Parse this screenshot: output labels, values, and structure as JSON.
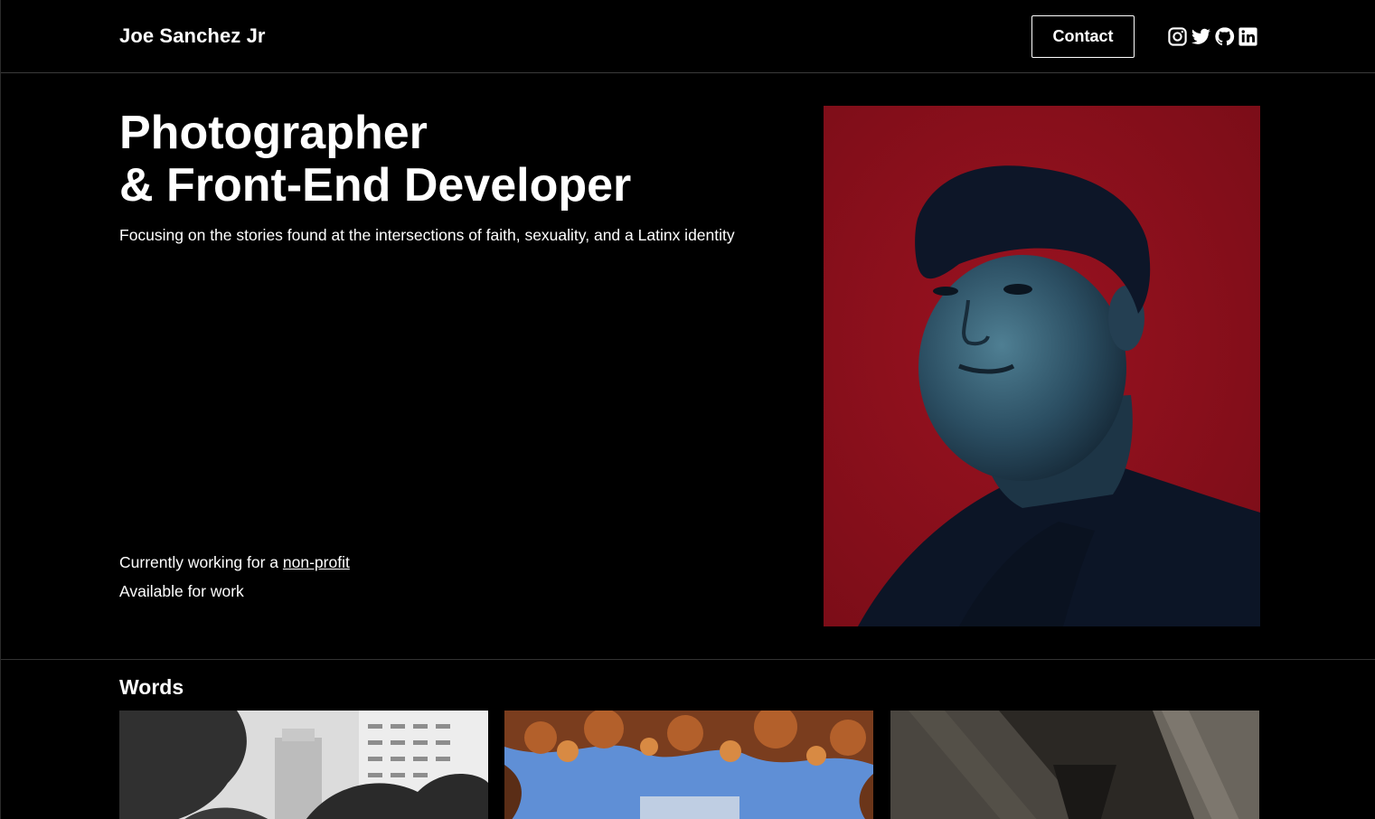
{
  "header": {
    "brand": "Joe Sanchez Jr",
    "contact_label": "Contact",
    "socials": [
      {
        "icon": "instagram-icon"
      },
      {
        "icon": "twitter-icon"
      },
      {
        "icon": "github-icon"
      },
      {
        "icon": "linkedin-icon"
      }
    ]
  },
  "hero": {
    "title_line1": "Photographer",
    "title_line2": "& Front-End Developer",
    "subtitle": "Focusing on the stories found at the intersections of faith, sexuality, and a Latinx identity",
    "status_prefix": "Currently working for a ",
    "status_link": "non-profit",
    "availability": "Available for work",
    "portrait_background": "#8a0f1c"
  },
  "words": {
    "title": "Words",
    "cards": [
      {
        "image": "city-buildings-bw-photo"
      },
      {
        "image": "autumn-leaves-sky-photo"
      },
      {
        "image": "concrete-architecture-photo"
      }
    ]
  }
}
